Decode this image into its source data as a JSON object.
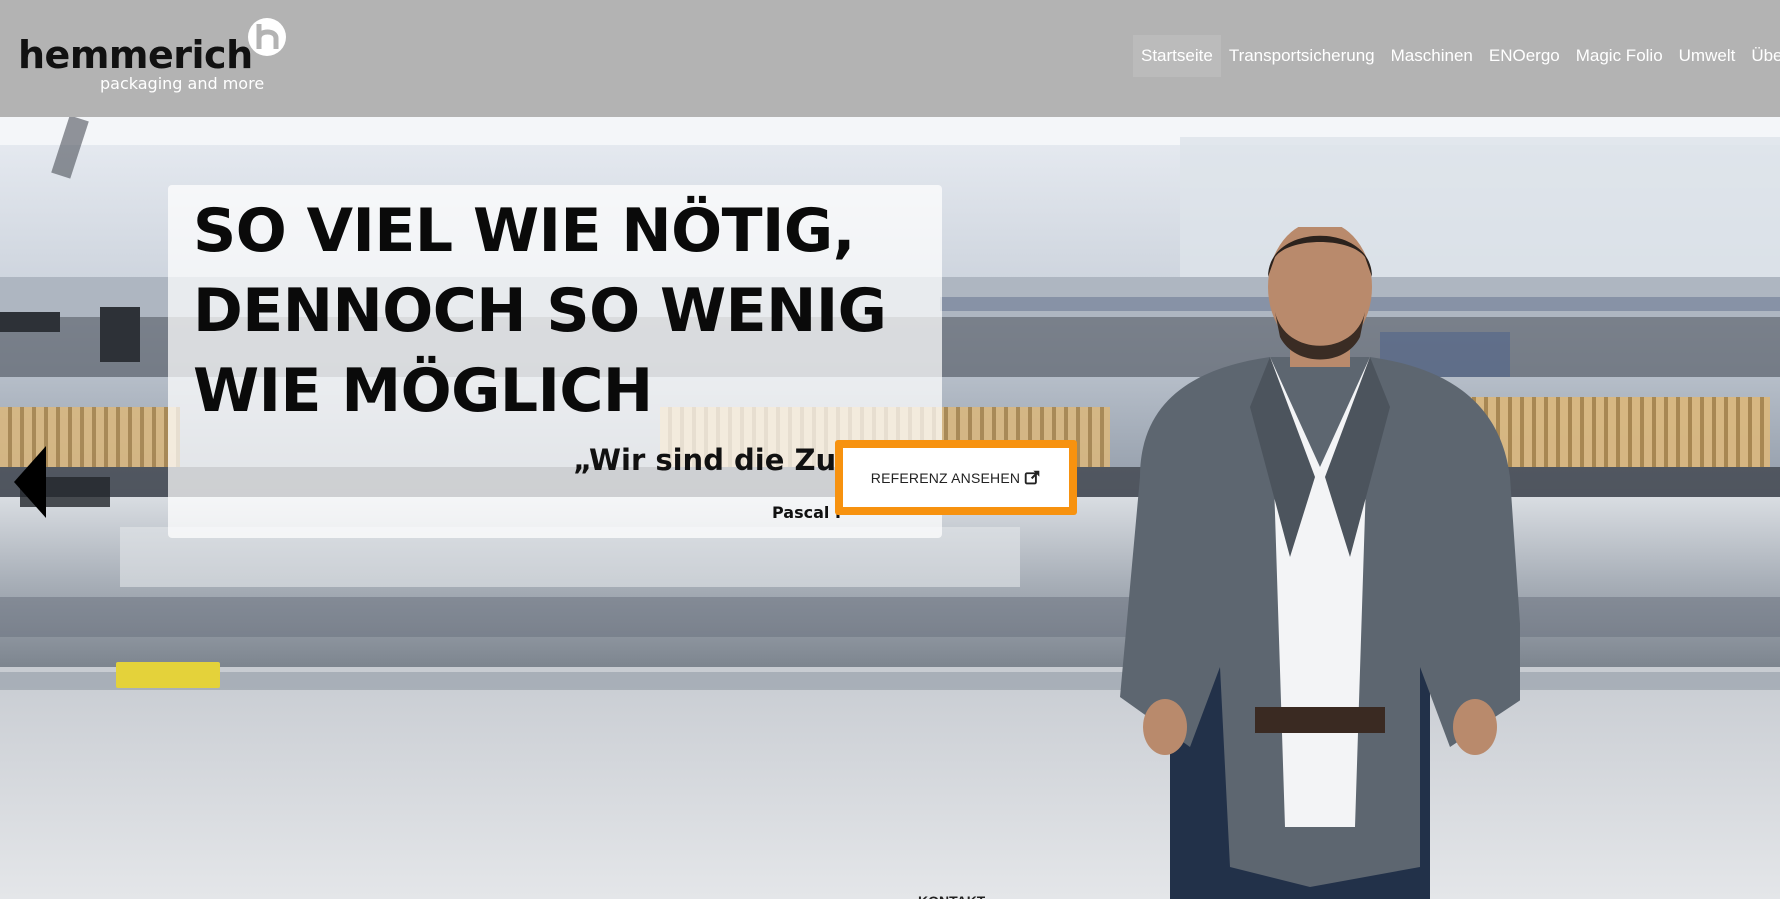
{
  "header": {
    "logo": {
      "word": "hemmerich",
      "tagline": "packaging and more"
    },
    "nav": [
      {
        "label": "Startseite",
        "active": true
      },
      {
        "label": "Transportsicherung",
        "active": false
      },
      {
        "label": "Maschinen",
        "active": false
      },
      {
        "label": "ENOergo",
        "active": false
      },
      {
        "label": "Magic Folio",
        "active": false
      },
      {
        "label": "Umwelt",
        "active": false
      },
      {
        "label": "Übe",
        "active": false
      }
    ]
  },
  "hero": {
    "headline": [
      "SO VIEL WIE NÖTIG,",
      "DENNOCH SO WENIG",
      "WIE MÖGLICH"
    ],
    "quote": "„Wir sind die Zuku",
    "author": "Pascal H",
    "cta_label": "REFERENZ ANSEHEN",
    "cta_icon": "external-link-icon",
    "slider_prev_icon": "triangle-left-icon",
    "footer_peek": "KONTAKT"
  },
  "colors": {
    "header_bg": "#b3b3b3",
    "cta_border": "#f7920f",
    "text_dark": "#0a0a0a"
  }
}
